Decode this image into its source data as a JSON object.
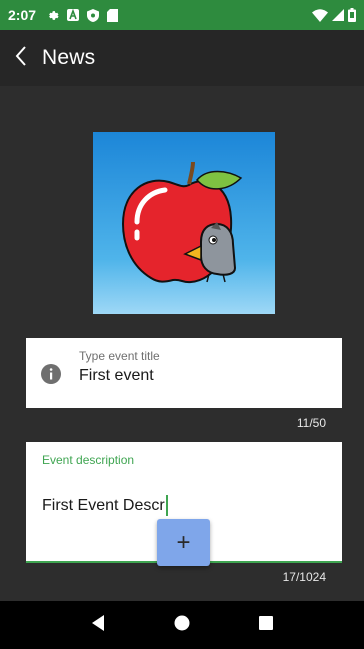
{
  "status_bar": {
    "time": "2:07",
    "left_icons": [
      "settings-icon",
      "a-badge-icon",
      "shield-icon",
      "sd-card-icon"
    ],
    "right_icons": [
      "wifi-icon",
      "signal-icon",
      "battery-icon"
    ]
  },
  "app_bar": {
    "title": "News",
    "back_icon": "chevron-left-icon"
  },
  "event_image": {
    "description_icon": "apple-with-bird-illustration"
  },
  "title_field": {
    "label": "Type event title",
    "value": "First event",
    "counter": "11/50",
    "icon": "info-icon"
  },
  "description_field": {
    "label": "Event description",
    "value": "First Event Descr",
    "counter": "17/1024"
  },
  "fab": {
    "label": "+"
  },
  "nav_bar": {
    "buttons": [
      "back-triangle-icon",
      "home-circle-icon",
      "recents-square-icon"
    ]
  },
  "colors": {
    "status_bar": "#2e8b3e",
    "app_bar": "#262626",
    "background": "#2d2d2d",
    "accent_green": "#3fa551",
    "fab": "#7fa6ea"
  }
}
